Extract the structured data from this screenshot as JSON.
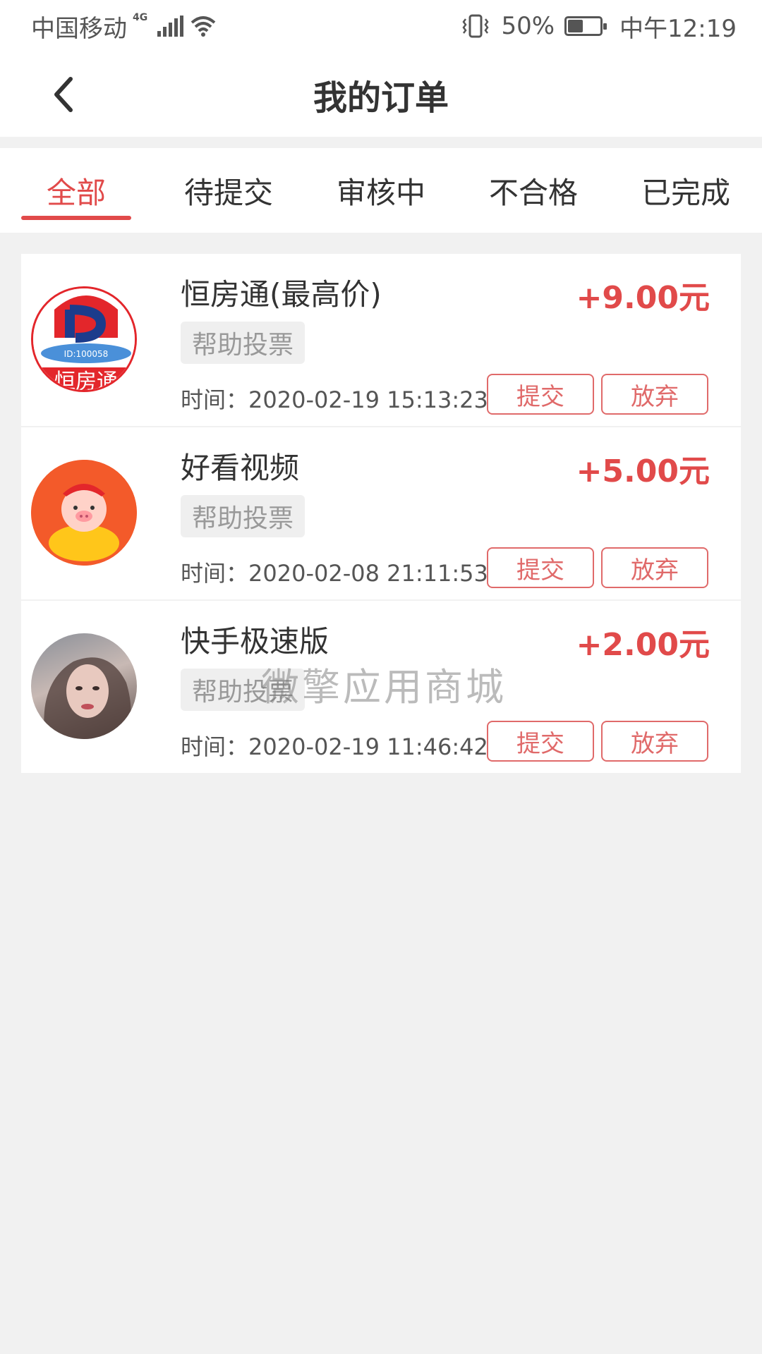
{
  "status_bar": {
    "carrier": "中国移动",
    "network": "4G",
    "battery": "50%",
    "battery_level": 0.5,
    "time": "中午12:19"
  },
  "header": {
    "title": "我的订单",
    "back_icon": "chevron-left-icon"
  },
  "tabs": [
    {
      "label": "全部",
      "active": true
    },
    {
      "label": "待提交",
      "active": false
    },
    {
      "label": "审核中",
      "active": false
    },
    {
      "label": "不合格",
      "active": false
    },
    {
      "label": "已完成",
      "active": false
    }
  ],
  "orders": [
    {
      "name": "恒房通(最高价)",
      "amount": "+9.00元",
      "tag": "帮助投票",
      "time": "时间：2020-02-19 15:13:23",
      "submit_label": "提交",
      "abandon_label": "放弃",
      "avatar_text": "恒房通",
      "avatar_id": "ID:100058"
    },
    {
      "name": "好看视频",
      "amount": "+5.00元",
      "tag": "帮助投票",
      "time": "时间：2020-02-08 21:11:53",
      "submit_label": "提交",
      "abandon_label": "放弃"
    },
    {
      "name": "快手极速版",
      "amount": "+2.00元",
      "tag": "帮助投票",
      "time": "时间：2020-02-19 11:46:42",
      "submit_label": "提交",
      "abandon_label": "放弃"
    }
  ],
  "watermark": "微擎应用商城",
  "colors": {
    "accent": "#e14a4a",
    "background": "#f1f1f1"
  }
}
